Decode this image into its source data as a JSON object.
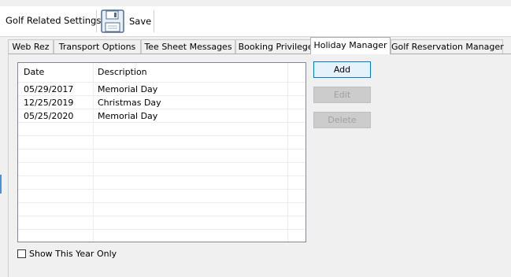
{
  "toolbar": {
    "title": "Golf Related Settings",
    "save_label": "Save",
    "save_icon": "floppy-disk-icon"
  },
  "tabs": [
    {
      "label": "Web Rez",
      "active": false
    },
    {
      "label": "Transport Options",
      "active": false
    },
    {
      "label": "Tee Sheet Messages",
      "active": false
    },
    {
      "label": "Booking Privileges",
      "active": false
    },
    {
      "label": "Holiday Manager",
      "active": true
    },
    {
      "label": "Golf Reservation Manager",
      "active": false
    }
  ],
  "holiday_grid": {
    "columns": [
      "Date",
      "Description"
    ],
    "rows": [
      {
        "date": "05/29/2017",
        "description": "Memorial Day"
      },
      {
        "date": "12/25/2019",
        "description": "Christmas Day"
      },
      {
        "date": "05/25/2020",
        "description": "Memorial Day"
      }
    ]
  },
  "buttons": {
    "add": "Add",
    "edit": "Edit",
    "delete": "Delete"
  },
  "filter": {
    "show_this_year_only_label": "Show This Year Only",
    "show_this_year_only_checked": false
  },
  "colors": {
    "accent": "#0078d7",
    "disabled_text": "#a0a0a0"
  }
}
